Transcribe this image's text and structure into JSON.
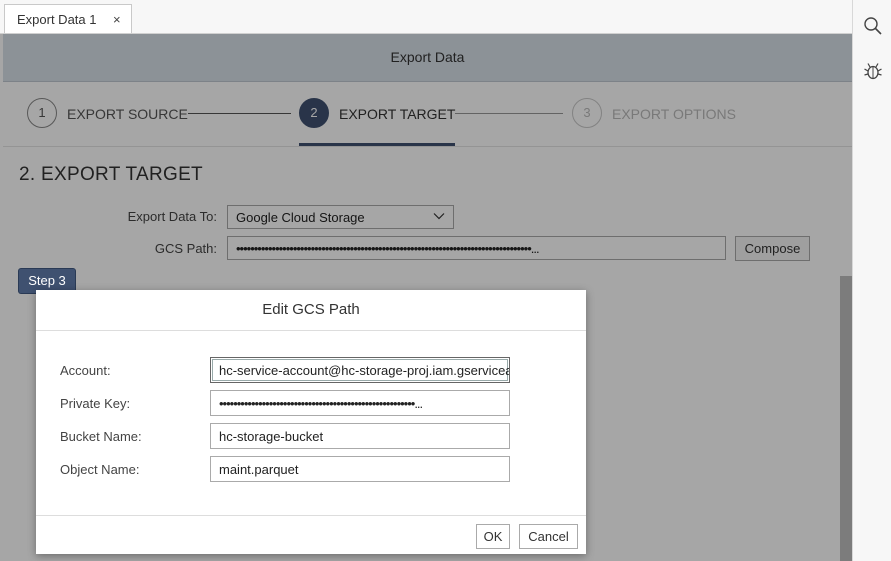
{
  "tab": {
    "label": "Export Data 1",
    "close": "×"
  },
  "header": {
    "title": "Export Data"
  },
  "steps": [
    {
      "number": "1",
      "label": "EXPORT SOURCE"
    },
    {
      "number": "2",
      "label": "EXPORT TARGET"
    },
    {
      "number": "3",
      "label": "EXPORT OPTIONS"
    }
  ],
  "section": {
    "title": "2. EXPORT TARGET",
    "export_to_label": "Export Data To:",
    "export_to_value": "Google Cloud Storage",
    "gcs_path_label": "GCS Path:",
    "gcs_path_value": "•••••••••••••••••••••••••••••••••••••••••••••••••••••••••••••••••••••••••••••••••••...",
    "compose_label": "Compose"
  },
  "step_badge": "Step 3",
  "dialog": {
    "title": "Edit GCS Path",
    "fields": [
      {
        "label": "Account:",
        "value": "hc-service-account@hc-storage-proj.iam.gserviceaccount.com"
      },
      {
        "label": "Private Key:",
        "value": "•••••••••••••••••••••••••••••••••••••••••••••••••••••••..."
      },
      {
        "label": "Bucket Name:",
        "value": "hc-storage-bucket"
      },
      {
        "label": "Object Name:",
        "value": "maint.parquet"
      }
    ],
    "ok_label": "OK",
    "cancel_label": "Cancel"
  },
  "colors": {
    "accent": "#3f5170",
    "header_bg": "#d8e0e9"
  },
  "icons": {
    "rail_top": "search-icon",
    "rail_bottom": "bug-icon"
  }
}
